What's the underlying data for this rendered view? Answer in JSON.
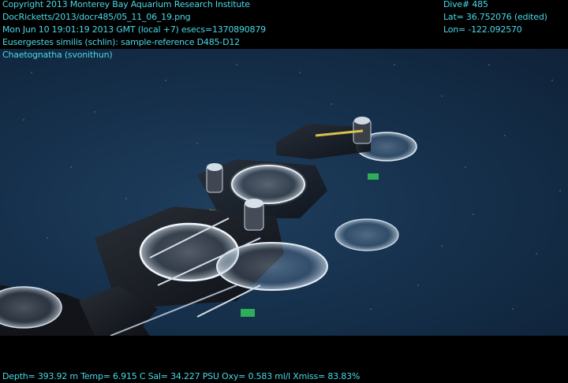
{
  "overlay": {
    "copyright": "Copyright 2013 Monterey Bay Aquarium Research Institute",
    "file_path": "DocRicketts/2013/docr485/05_11_06_19.png",
    "timestamp": "Mon Jun 10 19:01:19 2013 GMT (local +7)  esecs=1370890879",
    "annotation_1": "Eusergestes similis (schlin): sample-reference D485-D12",
    "annotation_2": "Chaetognatha (svonithun)",
    "dive": "Dive# 485",
    "lat": "Lat= 36.752076 (edited)",
    "lon": "Lon= -122.092570",
    "sensors": "Depth= 393.92 m  Temp= 6.915 C  Sal= 34.227 PSU  Oxy= 0.583 ml/l  Xmiss= 83.83%"
  },
  "colors": {
    "overlay_text": "#4ad8e8",
    "water": "#16314d",
    "letterbox": "#000000"
  }
}
